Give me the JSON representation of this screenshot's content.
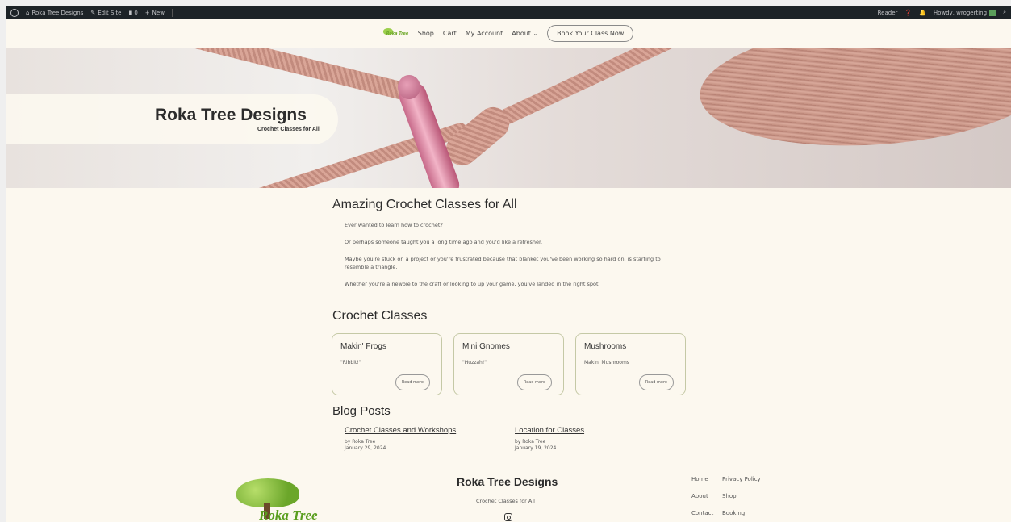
{
  "admin_bar": {
    "site_name": "Roka Tree Designs",
    "edit_site": "Edit Site",
    "comments_count": "0",
    "new_label": "New",
    "reader_label": "Reader",
    "howdy": "Howdy, wrogerting"
  },
  "nav": {
    "logo_text": "Roka Tree",
    "items": [
      "Shop",
      "Cart",
      "My Account",
      "About"
    ],
    "book_button": "Book Your Class Now"
  },
  "hero": {
    "title": "Roka Tree Designs",
    "tagline": "Crochet Classes for All"
  },
  "intro": {
    "heading": "Amazing Crochet Classes for All",
    "paragraphs": [
      "Ever wanted to learn how to crochet?",
      "Or perhaps someone taught you a long time ago and you'd like a refresher.",
      "Maybe you're stuck on a project or you're frustrated because that blanket you've been working so hard on, is starting to resemble a triangle.",
      "Whether you're a newbie to the craft or looking to up your game, you've landed in the right spot."
    ]
  },
  "classes": {
    "heading": "Crochet Classes",
    "read_more": "Read more",
    "items": [
      {
        "title": "Makin' Frogs",
        "excerpt": "\"Ribbit!\""
      },
      {
        "title": "Mini Gnomes",
        "excerpt": "\"Huzzah!\""
      },
      {
        "title": "Mushrooms",
        "excerpt": "Makin' Mushrooms"
      }
    ]
  },
  "blog": {
    "heading": "Blog Posts",
    "posts": [
      {
        "title": "Crochet Classes and Workshops",
        "author": "by Roka Tree",
        "date": "January 29, 2024"
      },
      {
        "title": "Location for Classes",
        "author": "by Roka Tree",
        "date": "January 19, 2024"
      }
    ]
  },
  "footer": {
    "logo_text": "Roka Tree",
    "title": "Roka Tree Designs",
    "tagline": "Crochet Classes for All",
    "links": [
      "Home",
      "Privacy Policy",
      "About",
      "Shop",
      "Contact",
      "Booking"
    ]
  },
  "colors": {
    "page_bg": "#fcf8ef",
    "admin_bar": "#1d2327",
    "card_border": "#c5c9a6",
    "logo_green": "#6ba62a"
  }
}
